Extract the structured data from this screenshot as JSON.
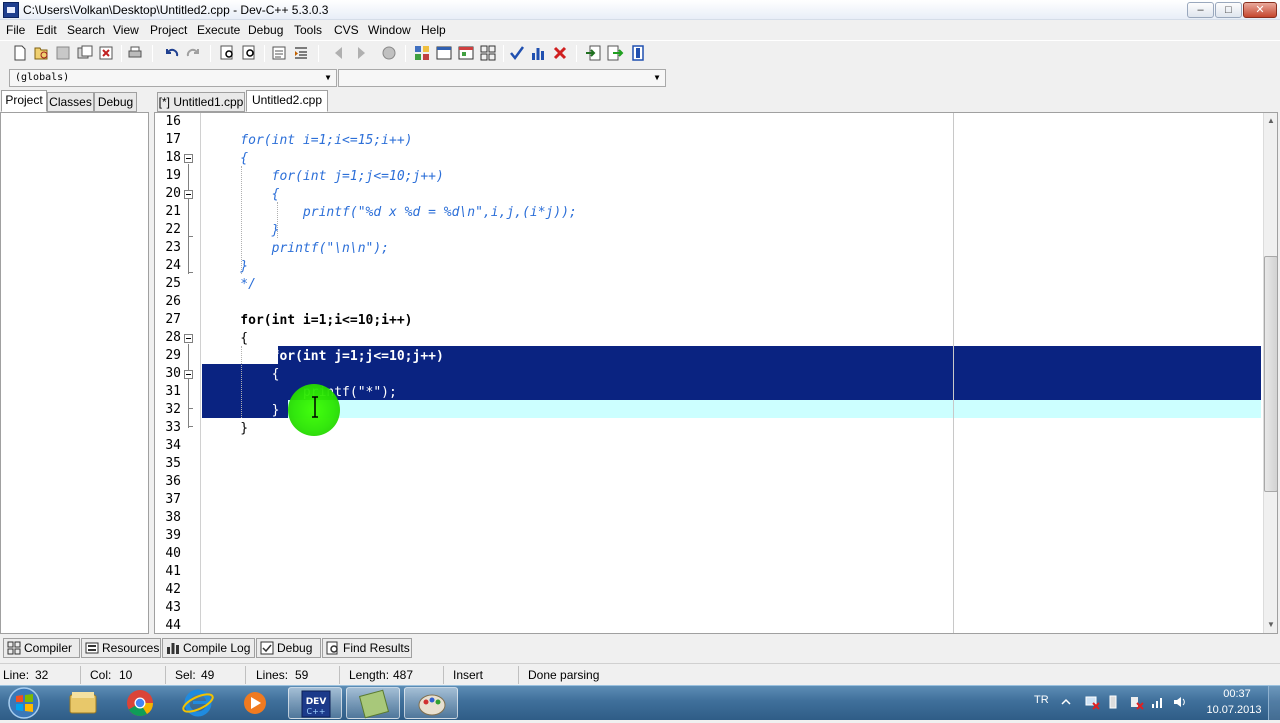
{
  "window": {
    "title": "C:\\Users\\Volkan\\Desktop\\Untitled2.cpp - Dev-C++ 5.3.0.3",
    "minimize_label": "–",
    "maximize_label": "□",
    "close_label": "✕"
  },
  "menu": [
    "File",
    "Edit",
    "Search",
    "View",
    "Project",
    "Execute",
    "Debug",
    "Tools",
    "CVS",
    "Window",
    "Help"
  ],
  "toolbar_icons": [
    "new-file-icon",
    "open-icon",
    "save-icon",
    "save-all-icon",
    "close-file-icon",
    "print-icon",
    "undo-icon",
    "redo-icon",
    "find-icon",
    "replace-icon",
    "goto-icon",
    "indent-icon",
    "unindent-icon",
    "back-icon",
    "forward-icon",
    "toggle-comment-icon",
    "new-project-icon",
    "class-browser-icon",
    "window-icon",
    "layout-icon",
    "check-syntax-icon",
    "chart-icon",
    "delete-icon",
    "import-icon",
    "export-icon",
    "options-icon"
  ],
  "combos": {
    "scope": "(globals)",
    "member": ""
  },
  "left_tabs": [
    "Project",
    "Classes",
    "Debug"
  ],
  "editor_tabs": [
    "[*] Untitled1.cpp",
    "Untitled2.cpp"
  ],
  "editor": {
    "lines": [
      {
        "n": "16",
        "text": ""
      },
      {
        "n": "17",
        "text": "    for(int i=1;i<=15;i++)"
      },
      {
        "n": "18",
        "text": "    {"
      },
      {
        "n": "19",
        "text": "        for(int j=1;j<=10;j++)"
      },
      {
        "n": "20",
        "text": "        {"
      },
      {
        "n": "21",
        "text": "            printf(\"%d x %d = %d\\n\",i,j,(i*j));"
      },
      {
        "n": "22",
        "text": "        }"
      },
      {
        "n": "23",
        "text": "        printf(\"\\n\\n\");"
      },
      {
        "n": "24",
        "text": "    }"
      },
      {
        "n": "25",
        "text": "    */"
      },
      {
        "n": "26",
        "text": ""
      },
      {
        "n": "27",
        "text": "    for(int i=1;i<=10;i++)"
      },
      {
        "n": "28",
        "text": "    {"
      },
      {
        "n": "29",
        "text": "        for(int j=1;j<=10;j++)"
      },
      {
        "n": "30",
        "text": "        {"
      },
      {
        "n": "31",
        "text": "            printf(\"*\");"
      },
      {
        "n": "32",
        "text": "        }"
      },
      {
        "n": "33",
        "text": "    }"
      },
      {
        "n": "34",
        "text": ""
      },
      {
        "n": "35",
        "text": ""
      },
      {
        "n": "36",
        "text": ""
      },
      {
        "n": "37",
        "text": ""
      },
      {
        "n": "38",
        "text": ""
      },
      {
        "n": "39",
        "text": ""
      },
      {
        "n": "40",
        "text": ""
      },
      {
        "n": "41",
        "text": ""
      },
      {
        "n": "42",
        "text": ""
      },
      {
        "n": "43",
        "text": ""
      },
      {
        "n": "44",
        "text": ""
      }
    ],
    "comment_color": "#2c6fd8",
    "selection_color": "#0a2381",
    "current_line_color": "#ccffff"
  },
  "bottom_tabs": [
    {
      "label": "Compiler",
      "icon": "compiler-grid-icon"
    },
    {
      "label": "Resources",
      "icon": "resources-icon"
    },
    {
      "label": "Compile Log",
      "icon": "compile-log-icon"
    },
    {
      "label": "Debug",
      "icon": "debug-check-icon"
    },
    {
      "label": "Find Results",
      "icon": "find-results-icon"
    }
  ],
  "status": {
    "line_label": "Line:",
    "line": "32",
    "col_label": "Col:",
    "col": "10",
    "sel_label": "Sel:",
    "sel": "49",
    "lines_label": "Lines:",
    "lines": "59",
    "length_label": "Length:",
    "length": "487",
    "mode": "Insert",
    "message": "Done parsing"
  },
  "taskbar": {
    "apps": [
      "explorer-icon",
      "chrome-icon",
      "internet-explorer-icon",
      "media-player-icon",
      "devcpp-icon",
      "notepad-icon",
      "paint-icon"
    ],
    "active_app": "devcpp-icon",
    "language": "TR",
    "time": "00:37",
    "date": "10.07.2013"
  }
}
